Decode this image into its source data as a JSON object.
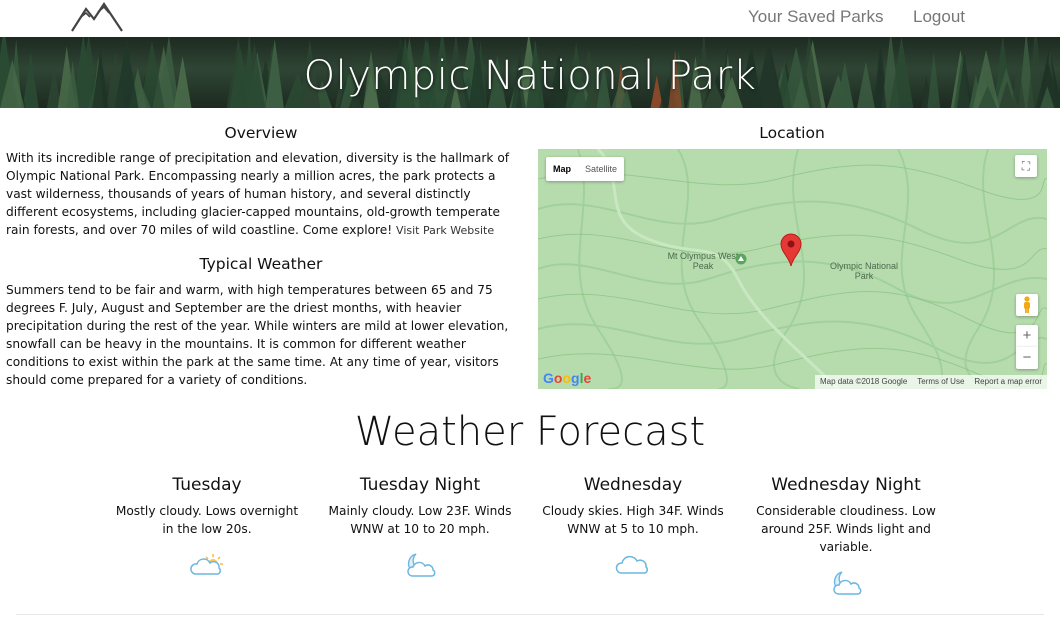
{
  "nav": {
    "logo_icon": "mountains-logo",
    "saved_parks": "Your Saved Parks",
    "logout": "Logout"
  },
  "hero": {
    "title": "Olympic National Park"
  },
  "overview": {
    "heading": "Overview",
    "text": "With its incredible range of precipitation and elevation, diversity is the hallmark of Olympic National Park. Encompassing nearly a million acres, the park protects a vast wilderness, thousands of years of human history, and several distinctly different ecosystems, including glacier-capped mountains, old-growth temperate rain forests, and over 70 miles of wild coastline. Come explore! ",
    "link": "Visit Park Website"
  },
  "typical_weather": {
    "heading": "Typical Weather",
    "text": "Summers tend to be fair and warm, with high temperatures between 65 and 75 degrees F. July, August and September are the driest months, with heavier precipitation during the rest of the year. While winters are mild at lower elevation, snowfall can be heavy in the mountains. It is common for different weather conditions to exist within the park at the same time. At any time of year, visitors should come prepared for a variety of conditions."
  },
  "location": {
    "heading": "Location",
    "map_tab": "Map",
    "satellite_tab": "Satellite",
    "label_peak": "Mt Olympus West Peak",
    "label_park": "Olympic National Park",
    "zoom_in": "+",
    "zoom_out": "−",
    "google": "Google",
    "map_data": "Map data ©2018 Google",
    "terms": "Terms of Use",
    "report": "Report a map error",
    "colors": {
      "land": "#b6dcae",
      "marker": "#e53935"
    }
  },
  "forecast": {
    "heading": "Weather Forecast",
    "periods": [
      {
        "name": "Tuesday",
        "desc": "Mostly cloudy. Lows overnight in the low 20s.",
        "icon": "partly-cloudy-day-icon"
      },
      {
        "name": "Tuesday Night",
        "desc": "Mainly cloudy. Low 23F. Winds WNW at 10 to 20 mph.",
        "icon": "partly-cloudy-night-icon"
      },
      {
        "name": "Wednesday",
        "desc": "Cloudy skies. High 34F. Winds WNW at 5 to 10 mph.",
        "icon": "cloud-icon"
      },
      {
        "name": "Wednesday Night",
        "desc": "Considerable cloudiness. Low around 25F. Winds light and variable.",
        "icon": "partly-cloudy-night-icon"
      }
    ]
  }
}
